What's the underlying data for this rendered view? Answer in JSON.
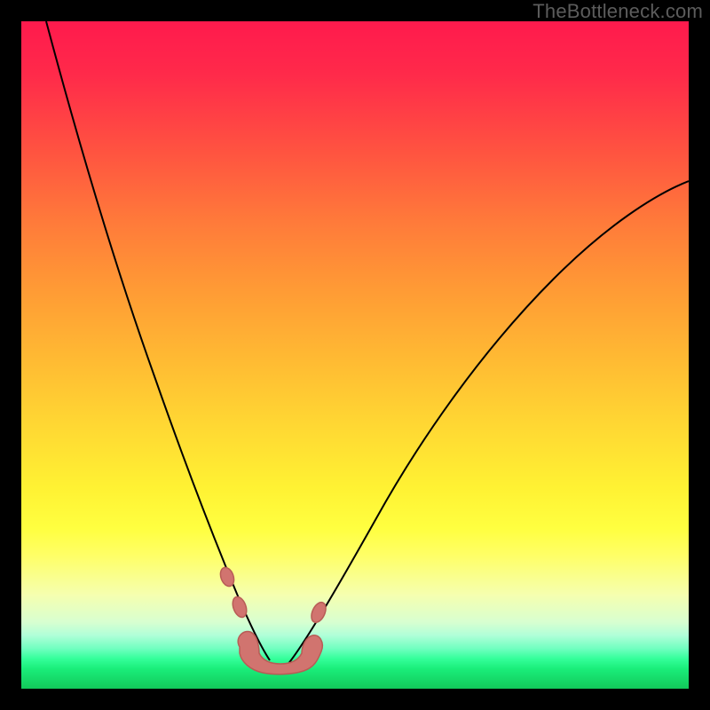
{
  "watermark": "TheBottleneck.com",
  "chart_data": {
    "type": "line",
    "title": "",
    "xlabel": "",
    "ylabel": "",
    "xlim": [
      0,
      100
    ],
    "ylim": [
      0,
      100
    ],
    "series": [
      {
        "name": "left-curve",
        "x": [
          0,
          5,
          10,
          15,
          20,
          25,
          28,
          31,
          34,
          36,
          38,
          40
        ],
        "y": [
          100,
          82,
          65,
          50,
          37,
          25,
          18,
          12,
          8,
          5,
          4,
          4
        ]
      },
      {
        "name": "right-curve",
        "x": [
          40,
          44,
          48,
          55,
          62,
          70,
          78,
          86,
          94,
          100
        ],
        "y": [
          4,
          5,
          8,
          15,
          24,
          36,
          49,
          60,
          70,
          76
        ]
      }
    ],
    "annotations": [
      {
        "name": "pink-blob-bottom",
        "approx_x": 37,
        "approx_y": 4
      },
      {
        "name": "pink-node-left-upper",
        "approx_x": 30,
        "approx_y": 13
      },
      {
        "name": "pink-node-left-lower",
        "approx_x": 32,
        "approx_y": 9
      },
      {
        "name": "pink-node-right",
        "approx_x": 44,
        "approx_y": 9
      }
    ],
    "background": {
      "gradient_top": "#ff1a4d",
      "gradient_mid": "#ffd633",
      "gradient_yellow": "#ffff40",
      "gradient_bottom": "#12c85a"
    }
  }
}
